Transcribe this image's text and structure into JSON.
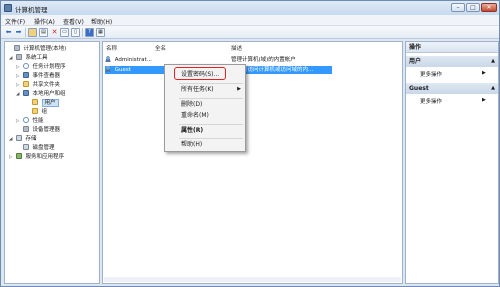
{
  "window": {
    "title": "计算机管理"
  },
  "menubar": [
    "文件(F)",
    "操作(A)",
    "查看(V)",
    "帮助(H)"
  ],
  "toolbar": {
    "icons": [
      "back-arrow-icon",
      "forward-arrow-icon",
      "up-folder-icon",
      "show-hide-tree-icon",
      "delete-icon",
      "properties-icon",
      "export-icon",
      "help-icon",
      "view-icon"
    ]
  },
  "tree": [
    {
      "label": "计算机管理(本地)",
      "expander": "",
      "icon": "computer-icon"
    },
    {
      "label": "系统工具",
      "expander": "◢",
      "icon": "tools-icon"
    },
    {
      "label": "任务计划程序",
      "expander": "▷",
      "icon": "clock-icon"
    },
    {
      "label": "事件查看器",
      "expander": "▷",
      "icon": "event-viewer-icon"
    },
    {
      "label": "共享文件夹",
      "expander": "▷",
      "icon": "shared-folder-icon"
    },
    {
      "label": "本地用户和组",
      "expander": "◢",
      "icon": "users-groups-icon"
    },
    {
      "label": "用户",
      "expander": "",
      "icon": "folder-icon"
    },
    {
      "label": "组",
      "expander": "",
      "icon": "folder-icon"
    },
    {
      "label": "性能",
      "expander": "▷",
      "icon": "performance-icon"
    },
    {
      "label": "设备管理器",
      "expander": "",
      "icon": "device-manager-icon"
    },
    {
      "label": "存储",
      "expander": "◢",
      "icon": "storage-icon"
    },
    {
      "label": "磁盘管理",
      "expander": "",
      "icon": "disk-icon"
    },
    {
      "label": "服务和应用程序",
      "expander": "▷",
      "icon": "services-icon"
    }
  ],
  "list": {
    "columns": [
      "名称",
      "全名",
      "描述"
    ],
    "rows": [
      {
        "name": "Administrat...",
        "fullname": "",
        "desc": "管理计算机(域)的内置帐户"
      },
      {
        "name": "Guest",
        "fullname": "",
        "desc": "供来宾访问计算机或访问域的内..."
      }
    ]
  },
  "context_menu": {
    "items": [
      {
        "label": "设置密码(S)...",
        "bold": false,
        "submenu": false
      },
      {
        "label": "所有任务(K)",
        "bold": false,
        "submenu": true
      },
      {
        "label": "删除(D)",
        "bold": false,
        "submenu": false
      },
      {
        "label": "重命名(M)",
        "bold": false,
        "submenu": false
      },
      {
        "label": "属性(R)",
        "bold": true,
        "submenu": false
      },
      {
        "label": "帮助(H)",
        "bold": false,
        "submenu": false
      }
    ],
    "submenu_arrow": "▶",
    "highlight_color": "#e02424"
  },
  "actions": {
    "header": "操作",
    "sections": [
      {
        "title": "用户",
        "item": "更多操作"
      },
      {
        "title": "Guest",
        "item": "更多操作"
      }
    ],
    "caret": "▲",
    "item_caret": "▶"
  },
  "colors": {
    "selection": "#3399ff",
    "accent": "#6a8fc2"
  }
}
